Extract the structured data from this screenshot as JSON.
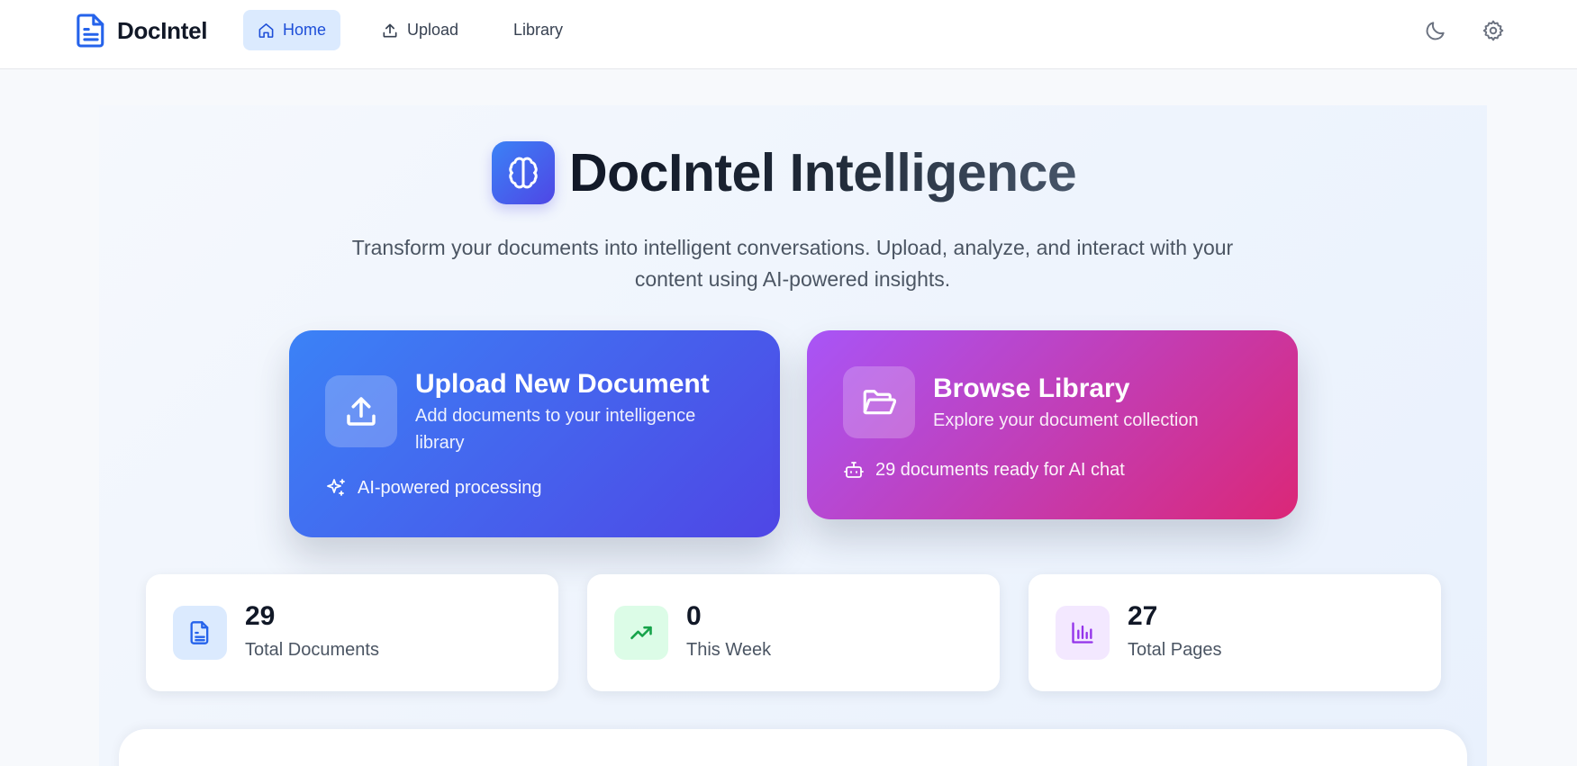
{
  "app": {
    "brand_name": "DocIntel",
    "brand_icon": "document-icon",
    "accent": "#2563eb"
  },
  "nav": {
    "items": [
      {
        "label": "Home",
        "icon": "home-icon",
        "active": true
      },
      {
        "label": "Upload",
        "icon": "upload-icon",
        "active": false
      },
      {
        "label": "Library",
        "icon": "",
        "active": false
      }
    ],
    "actions": [
      {
        "icon": "moon-icon"
      },
      {
        "icon": "gear-icon"
      }
    ]
  },
  "hero": {
    "icon": "brain-icon",
    "title": "DocIntel Intelligence",
    "subtitle": "Transform your documents into intelligent conversations. Upload, analyze, and interact with your content using AI-powered insights."
  },
  "cards": {
    "upload": {
      "icon": "upload-icon",
      "title": "Upload New Document",
      "description": "Add documents to your intelligence library",
      "footer_icon": "sparkles-icon",
      "footer": "AI-powered processing",
      "colors": [
        "#3b82f6",
        "#4f46e5"
      ]
    },
    "library": {
      "icon": "folder-open-icon",
      "title": "Browse Library",
      "description": "Explore your document collection",
      "footer_icon": "bot-icon",
      "footer": "29 documents ready for AI chat",
      "colors": [
        "#a855f7",
        "#db2777"
      ]
    }
  },
  "stats": [
    {
      "icon": "document-icon",
      "value": "29",
      "label": "Total Documents",
      "color": "#2563eb"
    },
    {
      "icon": "trending-up-icon",
      "value": "0",
      "label": "This Week",
      "color": "#16a34a"
    },
    {
      "icon": "bar-chart-icon",
      "value": "27",
      "label": "Total Pages",
      "color": "#9333ea"
    }
  ]
}
